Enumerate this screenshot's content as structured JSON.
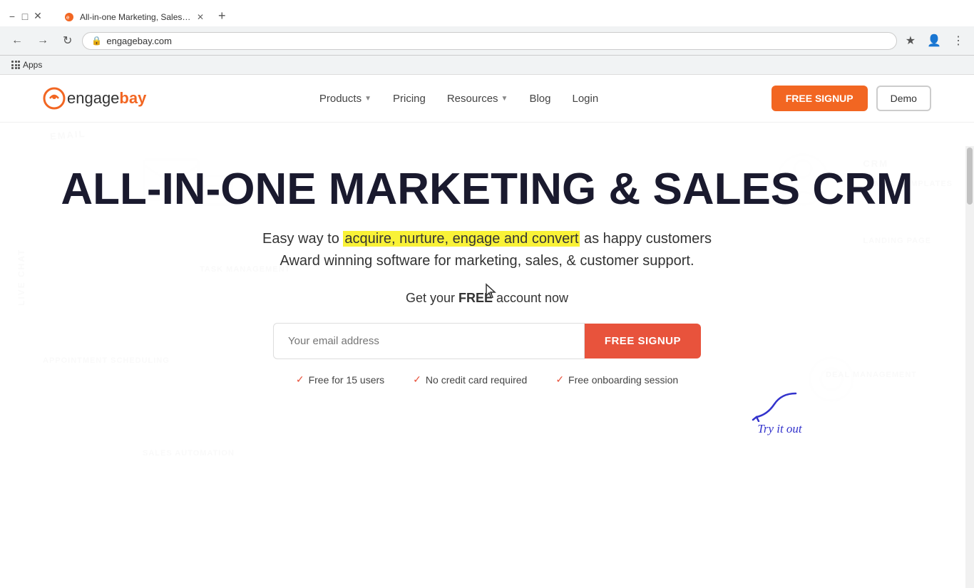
{
  "browser": {
    "tab": {
      "title": "All-in-one Marketing, Sales, Supp...",
      "favicon": "🟠"
    },
    "address": "engagebay.com",
    "bookmarks": [
      {
        "label": "Apps",
        "icon": "apps"
      }
    ]
  },
  "navbar": {
    "logo": {
      "text_before": "engage",
      "text_after": "bay",
      "icon_alt": "engagebay logo"
    },
    "links": [
      {
        "label": "Products",
        "has_dropdown": true
      },
      {
        "label": "Pricing",
        "has_dropdown": false
      },
      {
        "label": "Resources",
        "has_dropdown": true
      },
      {
        "label": "Blog",
        "has_dropdown": false
      },
      {
        "label": "Login",
        "has_dropdown": false
      }
    ],
    "free_signup_label": "FREE SIGNUP",
    "demo_label": "Demo"
  },
  "hero": {
    "title": "ALL-IN-ONE MARKETING & SALES CRM",
    "subtitle_pre": "Easy way to ",
    "subtitle_highlight": "acquire, nurture, engage and convert",
    "subtitle_post": " as happy customers",
    "subtitle2": "Award winning software for marketing, sales, & customer support.",
    "cta_text_pre": "Get your ",
    "cta_text_bold": "FREE",
    "cta_text_post": " account now",
    "email_placeholder": "Your email address",
    "signup_button_label": "FREE SIGNUP",
    "benefits": [
      {
        "text": "Free for 15 users"
      },
      {
        "text": "No credit card required"
      },
      {
        "text": "Free onboarding session"
      }
    ],
    "try_it_text": "Try it out"
  },
  "bg_labels": [
    "EMAIL",
    "CRM",
    "LIVE CHAT",
    "APPOINTMENT SCHEDULING",
    "TASK MANAGEMENT",
    "LANDING PAGE",
    "EMAIL TEMPLATES",
    "DEAL MANAGEMENT",
    "SALES AUTOMATION"
  ]
}
